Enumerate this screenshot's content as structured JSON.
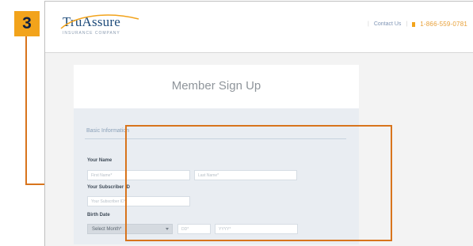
{
  "step": {
    "number": "3"
  },
  "header": {
    "logo_name": "TruAssure",
    "logo_tagline": "INSURANCE COMPANY",
    "contact_link": "Contact Us",
    "phone": "1-866-559-0781"
  },
  "card": {
    "title": "Member Sign Up"
  },
  "form": {
    "section_title": "Basic Information",
    "name_label": "Your Name",
    "first_name_placeholder": "First Name*",
    "last_name_placeholder": "Last Name*",
    "subscriber_label": "Your Subscriber ID",
    "subscriber_placeholder": "Your Subscriber ID*",
    "birth_label": "Birth Date",
    "month_value": "Select Month*",
    "day_placeholder": "DD*",
    "year_placeholder": "YYYY*"
  },
  "colors": {
    "badge": "#f2a31b",
    "highlight": "#d8741c",
    "logo_blue": "#1e4b7a"
  },
  "icons": [
    "logo-swoosh-icon",
    "phone-icon",
    "caret-down-icon"
  ]
}
